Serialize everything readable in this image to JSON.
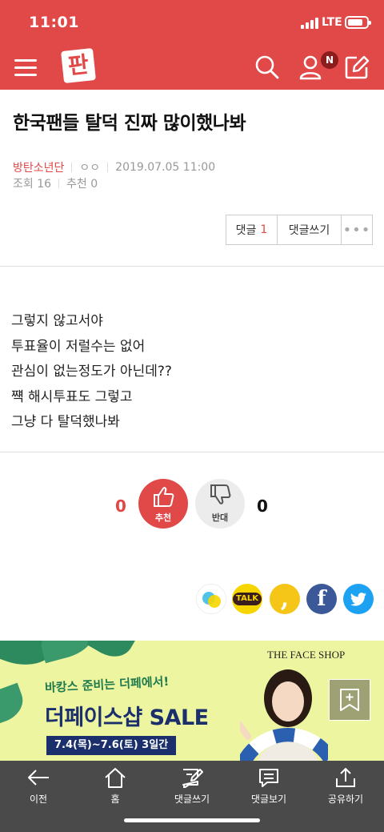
{
  "status_bar": {
    "time": "11:01",
    "network": "LTE"
  },
  "header": {
    "logo": "판",
    "notification_badge": "N"
  },
  "post": {
    "title": "한국팬들 탈덕 진짜 많이했나봐",
    "author": "방탄소년단",
    "nickname": "ㅇㅇ",
    "datetime": "2019.07.05 11:00",
    "views_label": "조회 16",
    "recommend_label": "추천 0",
    "body_lines": [
      "그렇지 않고서야",
      "투표율이 저럴수는 없어",
      "관심이 없는정도가 아닌데??",
      "쨱 해시투표도 그렇고",
      "그냥 다 탈덕했나봐"
    ]
  },
  "actions": {
    "comment_label": "댓글",
    "comment_count": "1",
    "write_comment_label": "댓글쓰기",
    "more_label": "•••"
  },
  "votes": {
    "up_count": "0",
    "up_label": "추천",
    "down_count": "0",
    "down_label": "반대"
  },
  "share": {
    "kakaotalk_label": "TALK",
    "kakao_story_label": ",",
    "facebook_label": "f"
  },
  "banner": {
    "brand": "THE FACE SHOP",
    "subtitle": "바캉스 준비는 더페에서!",
    "headline": "더페이스샵 SALE",
    "dates": "7.4(목)~7.6(토) 3일간"
  },
  "bottom_nav": {
    "items": [
      {
        "label": "이전"
      },
      {
        "label": "홈"
      },
      {
        "label": "댓글쓰기"
      },
      {
        "label": "댓글보기"
      },
      {
        "label": "공유하기"
      }
    ]
  },
  "colors": {
    "brand_red": "#e14848",
    "nav_bg": "#4a4a4a",
    "banner_bg": "#eef5a0",
    "banner_navy": "#1a2f6b"
  }
}
